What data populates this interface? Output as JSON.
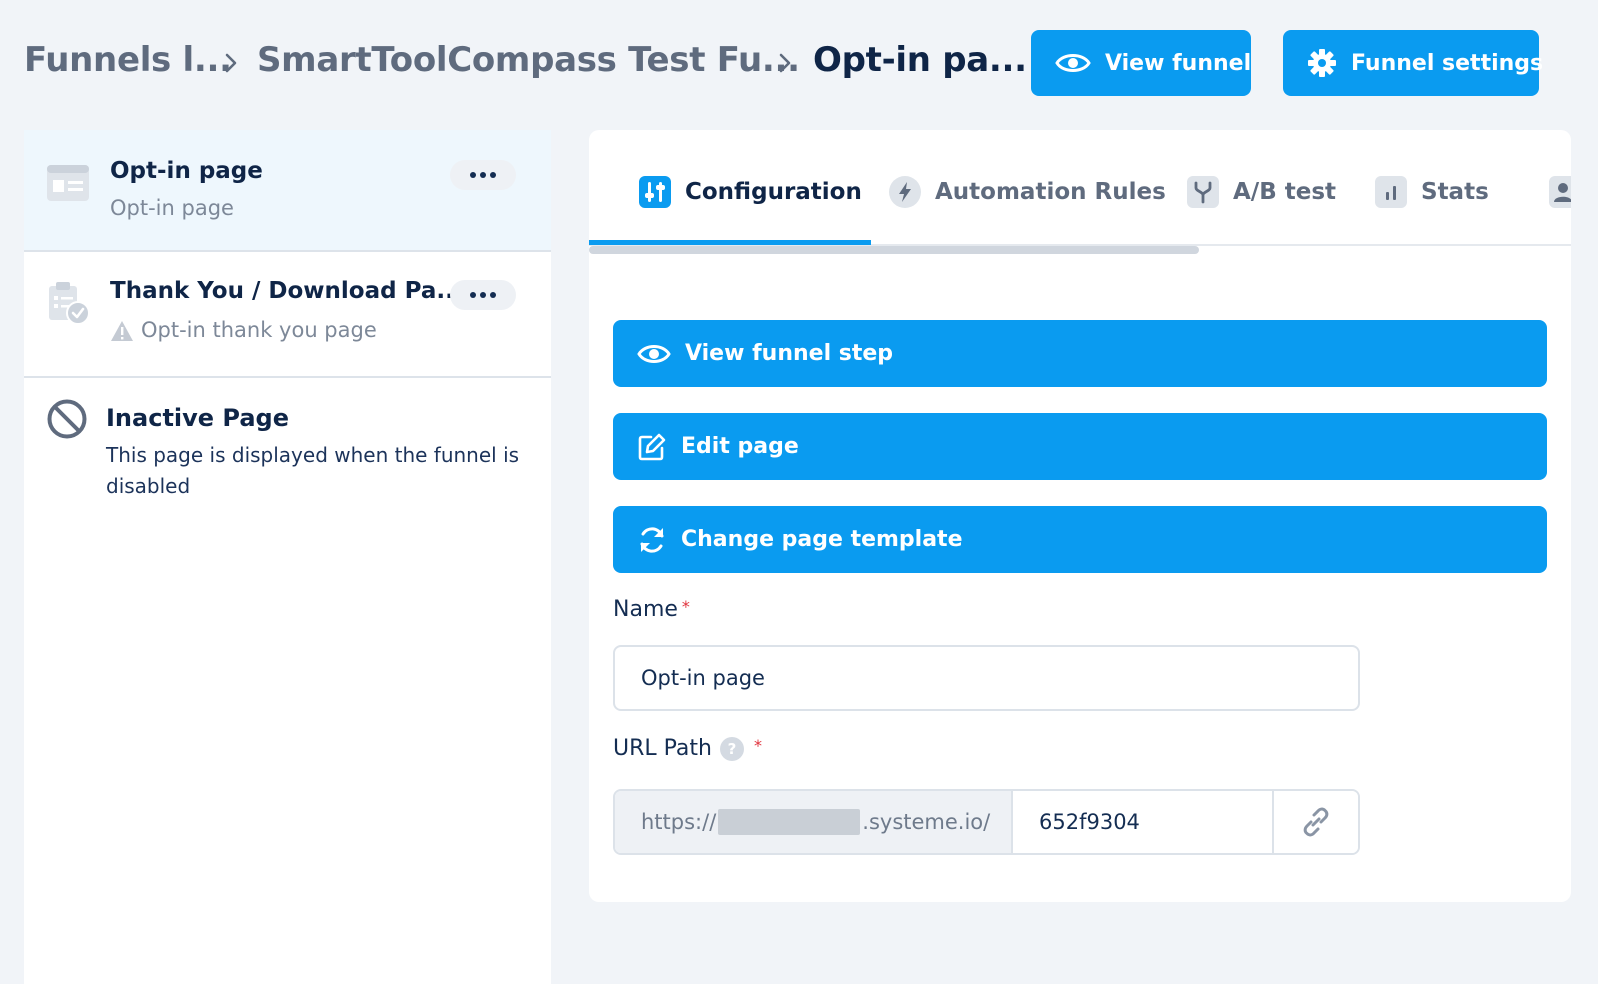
{
  "breadcrumb": {
    "items": [
      "Funnels l...",
      "SmartToolCompass Test Fu...",
      "Opt-in pa..."
    ]
  },
  "header": {
    "view_funnel_label": "View funnel",
    "funnel_settings_label": "Funnel settings"
  },
  "sidebar": {
    "steps": [
      {
        "title": "Opt-in page",
        "subtitle": "Opt-in page",
        "icon": "page-layout-icon",
        "active": true
      },
      {
        "title": "Thank You / Download Pa...",
        "subtitle": "Opt-in thank you page",
        "icon": "clipboard-check-icon",
        "warning": true,
        "active": false
      }
    ],
    "inactive": {
      "title": "Inactive Page",
      "description": "This page is displayed when the funnel is disabled"
    }
  },
  "tabs": [
    {
      "label": "Configuration",
      "icon": "sliders-icon",
      "active": true
    },
    {
      "label": "Automation Rules",
      "icon": "bolt-icon",
      "active": false
    },
    {
      "label": "A/B test",
      "icon": "split-icon",
      "active": false
    },
    {
      "label": "Stats",
      "icon": "bar-chart-icon",
      "active": false
    }
  ],
  "actions": {
    "view_step_label": "View funnel step",
    "edit_page_label": "Edit page",
    "change_template_label": "Change page template"
  },
  "form": {
    "name_label": "Name",
    "name_value": "Opt-in page",
    "url_label": "URL Path",
    "url_help": "?",
    "url_prefix_start": "https://",
    "url_prefix_end": ".systeme.io/",
    "url_value": "652f9304",
    "required_mark": "*"
  },
  "colors": {
    "primary": "#0a9bf0",
    "text_dark": "#0f2547",
    "text_muted": "#5f6b7e",
    "active_bg": "#eef7fd",
    "page_bg": "#f1f4f8"
  }
}
